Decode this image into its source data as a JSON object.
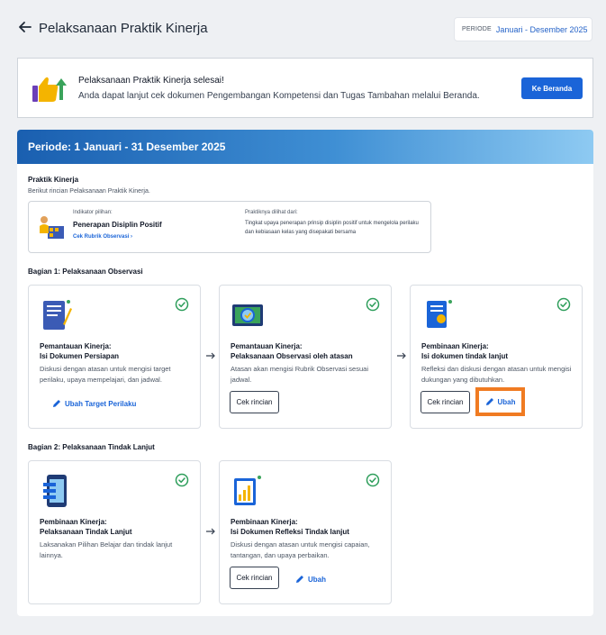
{
  "header": {
    "title": "Pelaksanaan Praktik Kinerja",
    "period_label": "PERIODE",
    "period_value": "Januari - Desember 2025"
  },
  "banner": {
    "title": "Pelaksanaan Praktik Kinerja selesai!",
    "subtitle": "Anda dapat lanjut cek dokumen Pengembangan Kompetensi dan Tugas Tambahan melalui Beranda.",
    "button": "Ke Beranda"
  },
  "main": {
    "period_title": "Periode: 1 Januari - 31 Desember 2025",
    "praktik_title": "Praktik Kinerja",
    "praktik_sub": "Berikut rincian Pelaksanaan Praktik Kinerja.",
    "indicator": {
      "label": "Indikator pilihan:",
      "name": "Penerapan Disiplin Positif",
      "link": "Cek Rubrik Observasi",
      "practice_label": "Praktiknya dilihat dari:",
      "practice_text": "Tingkat upaya penerapan prinsip disiplin positif untuk mengelola perilaku dan kebiasaan kelas yang disepakati bersama"
    },
    "section1": {
      "title": "Bagian 1: Pelaksanaan Observasi",
      "cards": [
        {
          "title_line1": "Pemantauan Kinerja:",
          "title_line2": "Isi Dokumen Persiapan",
          "desc": "Diskusi dengan atasan untuk mengisi target perilaku, upaya mempelajari, dan jadwal.",
          "link": "Ubah Target Perilaku"
        },
        {
          "title_line1": "Pemantauan Kinerja:",
          "title_line2": "Pelaksanaan Observasi oleh atasan",
          "desc": "Atasan akan mengisi Rubrik Observasi sesuai jadwal.",
          "button": "Cek rincian"
        },
        {
          "title_line1": "Pembinaan Kinerja:",
          "title_line2": "Isi dokumen tindak lanjut",
          "desc": "Refleksi dan diskusi dengan atasan untuk mengisi dukungan yang dibutuhkan.",
          "button": "Cek rincian",
          "link": "Ubah"
        }
      ]
    },
    "section2": {
      "title": "Bagian 2: Pelaksanaan Tindak Lanjut",
      "cards": [
        {
          "title_line1": "Pembinaan Kinerja:",
          "title_line2": "Pelaksanaan Tindak Lanjut",
          "desc": "Laksanakan Pilihan Belajar dan tindak lanjut lainnya."
        },
        {
          "title_line1": "Pembinaan Kinerja:",
          "title_line2": "Isi Dokumen Refleksi Tindak lanjut",
          "desc": "Diskusi dengan atasan untuk mengisi capaian, tantangan, dan upaya perbaikan.",
          "button": "Cek rincian",
          "link": "Ubah"
        }
      ]
    }
  },
  "colors": {
    "primary": "#1a64d8",
    "check": "#2e9e5b",
    "highlight": "#f07b22"
  }
}
